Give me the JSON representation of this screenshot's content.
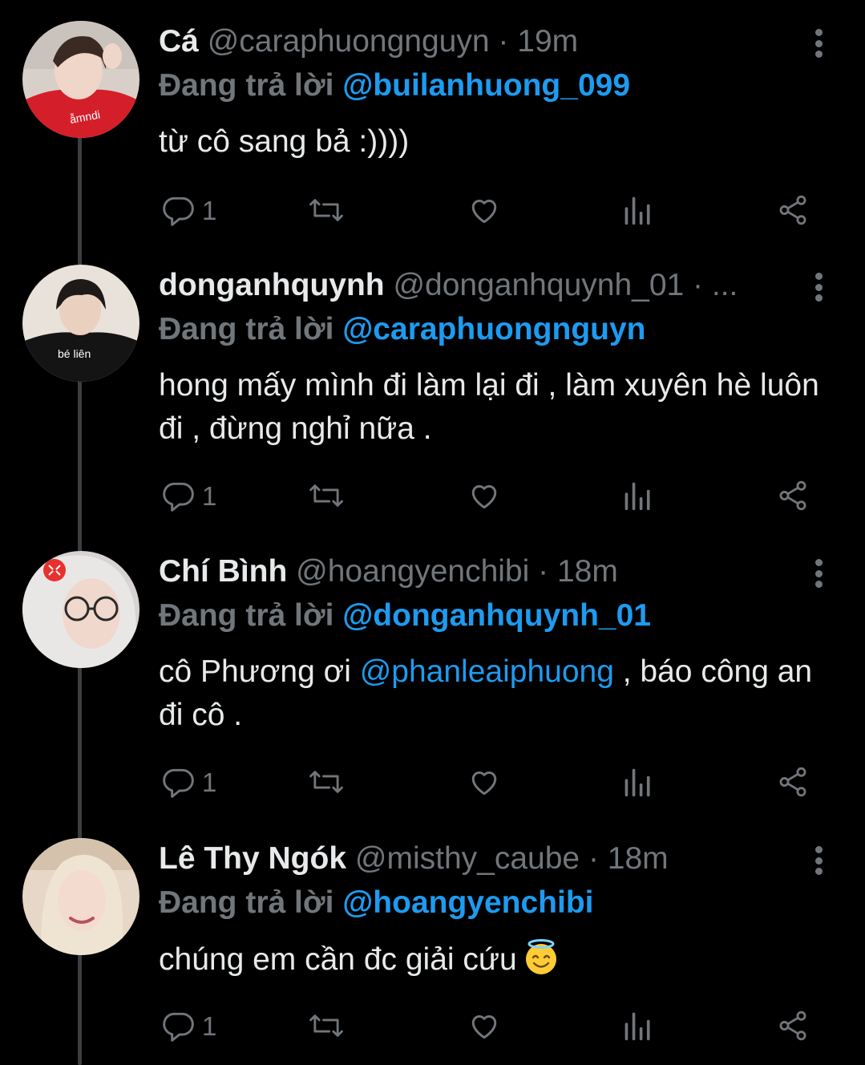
{
  "colors": {
    "background": "#000000",
    "text": "#e7e9ea",
    "secondary": "#71767b",
    "mention": "#1d9bf0",
    "thread_line": "#3a3d41"
  },
  "icons": {
    "reply": "reply-icon",
    "retweet": "retweet-icon",
    "like": "heart-icon",
    "views": "views-icon",
    "share": "share-icon",
    "more": "more-icon"
  },
  "tweets": [
    {
      "name": "Cá",
      "handle": "@caraphuongnguyn",
      "separator": "·",
      "time": "19m",
      "replying_prefix": "Đang trả lời",
      "replying_to": "@builanhuong_099",
      "text_parts": [
        "từ cô sang bả :))))"
      ],
      "reply_count": "1"
    },
    {
      "name": "donganhquynh",
      "handle": "@donganhquynh_01",
      "separator": "· ...",
      "time": "",
      "replying_prefix": "Đang trả lời",
      "replying_to": "@caraphuongnguyn",
      "text_parts": [
        "hong mấy mình đi làm lại đi , làm xuyên hè luôn đi , đừng nghỉ nữa ."
      ],
      "reply_count": "1"
    },
    {
      "name": "Chí Bình",
      "handle": "@hoangyenchibi",
      "separator": "·",
      "time": "18m",
      "replying_prefix": "Đang trả lời",
      "replying_to": "@donganhquynh_01",
      "text_parts": [
        "cô Phương ơi ",
        "@phanleaiphuong",
        " , báo công an đi cô ."
      ],
      "reply_count": "1"
    },
    {
      "name": "Lê Thy Ngók",
      "handle": "@misthy_caube",
      "separator": "·",
      "time": "18m",
      "replying_prefix": "Đang trả lời",
      "replying_to": "@hoangyenchibi",
      "text_parts": [
        "chúng em cần đc giải cứu"
      ],
      "emoji": "smiling-face-with-halo",
      "reply_count": "1"
    }
  ]
}
